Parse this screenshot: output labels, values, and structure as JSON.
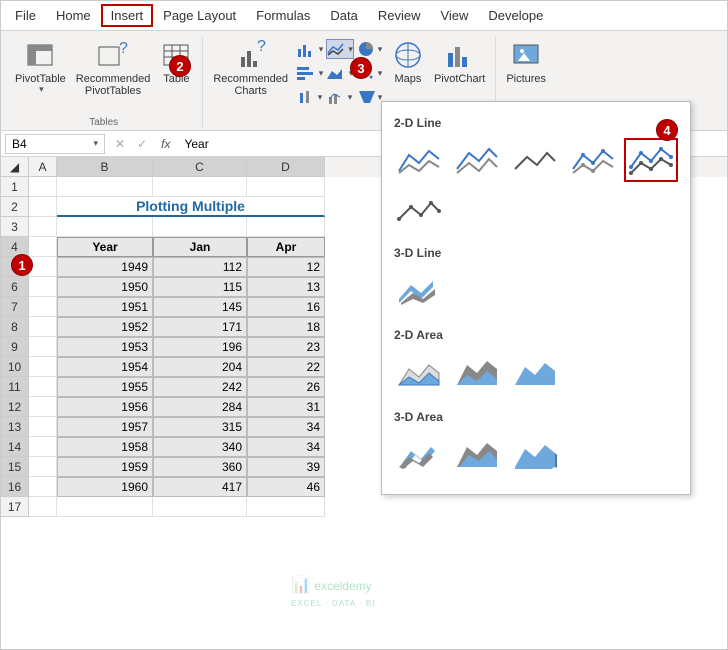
{
  "tabs": [
    "File",
    "Home",
    "Insert",
    "Page Layout",
    "Formulas",
    "Data",
    "Review",
    "View",
    "Develope"
  ],
  "active_tab": "Insert",
  "ribbon": {
    "tables_group": "Tables",
    "pivot": "PivotTable",
    "recpivot": "Recommended\nPivotTables",
    "table": "Table",
    "reccharts": "Recommended\nCharts",
    "maps": "Maps",
    "pivotchart": "PivotChart",
    "pictures": "Pictures"
  },
  "namebox": "B4",
  "formula_value": "Year",
  "fx_label": "fx",
  "title_cell": "Plotting Multiple ",
  "columns": [
    "A",
    "B",
    "C",
    "D"
  ],
  "table": {
    "headers": [
      "Year",
      "Jan",
      "Apr"
    ],
    "rows": [
      [
        "1949",
        "112",
        "12"
      ],
      [
        "1950",
        "115",
        "13"
      ],
      [
        "1951",
        "145",
        "16"
      ],
      [
        "1952",
        "171",
        "18"
      ],
      [
        "1953",
        "196",
        "23"
      ],
      [
        "1954",
        "204",
        "22"
      ],
      [
        "1955",
        "242",
        "26"
      ],
      [
        "1956",
        "284",
        "31"
      ],
      [
        "1957",
        "315",
        "34"
      ],
      [
        "1958",
        "340",
        "34"
      ],
      [
        "1959",
        "360",
        "39"
      ],
      [
        "1960",
        "417",
        "46"
      ]
    ]
  },
  "dropdown": {
    "sec1": "2-D Line",
    "sec2": "3-D Line",
    "sec3": "2-D Area",
    "sec4": "3-D Area"
  },
  "badges": {
    "1": "1",
    "2": "2",
    "3": "3",
    "4": "4"
  },
  "watermark": "exceldemy",
  "watermark_sub": "EXCEL · DATA · BI",
  "chart_data": {
    "type": "table",
    "title": "Plotting Multiple",
    "columns": [
      "Year",
      "Jan",
      "Apr"
    ],
    "rows": [
      [
        1949,
        112,
        12
      ],
      [
        1950,
        115,
        13
      ],
      [
        1951,
        145,
        16
      ],
      [
        1952,
        171,
        18
      ],
      [
        1953,
        196,
        23
      ],
      [
        1954,
        204,
        22
      ],
      [
        1955,
        242,
        26
      ],
      [
        1956,
        284,
        31
      ],
      [
        1957,
        315,
        34
      ],
      [
        1958,
        340,
        34
      ],
      [
        1959,
        360,
        39
      ],
      [
        1960,
        417,
        46
      ]
    ]
  }
}
